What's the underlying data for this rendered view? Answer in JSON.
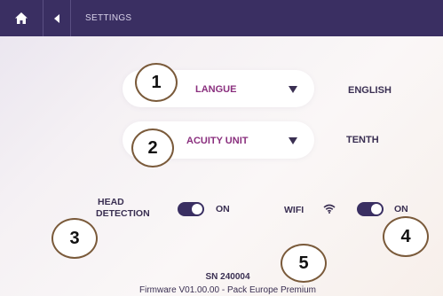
{
  "header": {
    "home_icon": "home-icon",
    "back_icon": "chevron-left-icon",
    "title": "SETTINGS"
  },
  "settings": {
    "language": {
      "label": "LANGUE",
      "value": "ENGLISH"
    },
    "acuity_unit": {
      "label": "ACUITY UNIT",
      "value": "TENTH"
    },
    "head_detection": {
      "label_line1": "HEAD",
      "label_line2": "DETECTION",
      "state": "ON",
      "enabled": true
    },
    "wifi": {
      "label": "WIFI",
      "icon": "wifi-icon",
      "state": "ON",
      "enabled": true
    }
  },
  "footer": {
    "serial": "SN 240004",
    "firmware": "Firmware V01.00.00 - Pack Europe Premium"
  },
  "callouts": [
    "1",
    "2",
    "3",
    "4",
    "5"
  ],
  "colors": {
    "header_bg": "#3a2f62",
    "accent": "#8a2f7e",
    "text": "#3a2f52"
  }
}
